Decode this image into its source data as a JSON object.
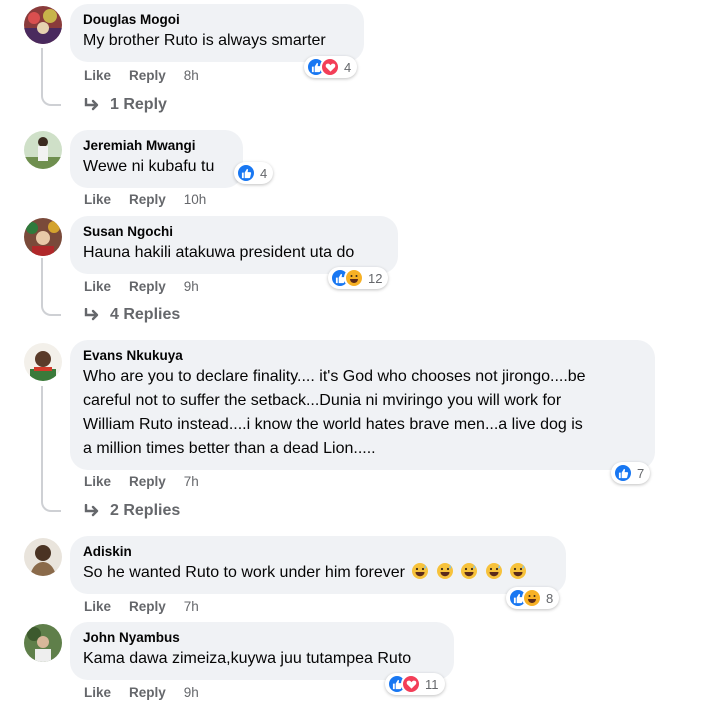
{
  "comments": [
    {
      "author": "Douglas Mogoi",
      "text": "My brother Ruto is always smarter",
      "like_label": "Like",
      "reply_label": "Reply",
      "time": "8h",
      "reactions": [
        "like",
        "love"
      ],
      "reaction_count": "4",
      "replies_label": "1 Reply"
    },
    {
      "author": "Jeremiah Mwangi",
      "text": "Wewe ni kubafu tu",
      "like_label": "Like",
      "reply_label": "Reply",
      "time": "10h",
      "reactions": [
        "like"
      ],
      "reaction_count": "4"
    },
    {
      "author": "Susan Ngochi",
      "text": "Hauna hakili atakuwa president uta do",
      "like_label": "Like",
      "reply_label": "Reply",
      "time": "9h",
      "reactions": [
        "like",
        "haha"
      ],
      "reaction_count": "12",
      "replies_label": "4 Replies"
    },
    {
      "author": "Evans Nkukuya",
      "text_lines": [
        "Who are you to declare finality.... it's God who chooses not jirongo....be",
        "careful not to suffer the setback...Dunia ni mviringo you will work for",
        "William Ruto instead....i know the world hates brave men...a live dog is",
        "a million times better than a dead Lion....."
      ],
      "like_label": "Like",
      "reply_label": "Reply",
      "time": "7h",
      "reactions": [
        "like"
      ],
      "reaction_count": "7",
      "replies_label": "2 Replies"
    },
    {
      "author": "Adiskin",
      "text": "So he wanted Ruto to work under him forever",
      "emoji": [
        "grinning-sweat-emoji",
        "grinning-sweat-emoji",
        "grinning-sweat-emoji",
        "grinning-sweat-emoji",
        "grinning-sweat-emoji"
      ],
      "like_label": "Like",
      "reply_label": "Reply",
      "time": "7h",
      "reactions": [
        "like",
        "haha"
      ],
      "reaction_count": "8"
    },
    {
      "author": "John Nyambus",
      "text": "Kama dawa zimeiza,kuywa juu tutampea Ruto",
      "like_label": "Like",
      "reply_label": "Reply",
      "time": "9h",
      "reactions": [
        "like",
        "love"
      ],
      "reaction_count": "11"
    }
  ],
  "colors": {
    "bubble": "#f0f2f5",
    "muted": "#65676b",
    "like": "#1877f2",
    "love": "#f33e58",
    "haha": "#f7b125"
  }
}
